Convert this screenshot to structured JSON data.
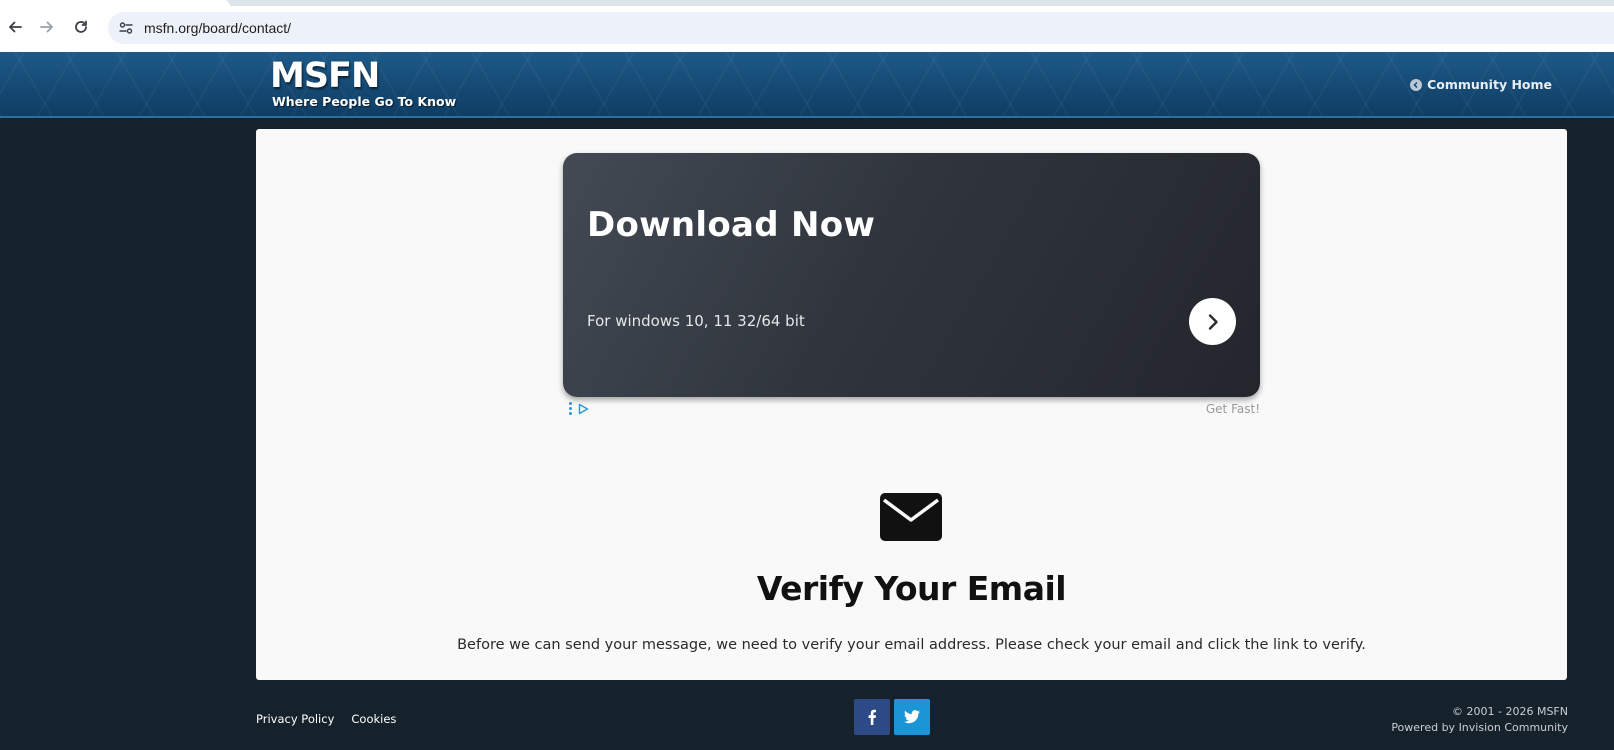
{
  "browser": {
    "url": "msfn.org/board/contact/",
    "back_icon": "arrow-left-icon",
    "forward_icon": "arrow-right-icon",
    "reload_icon": "reload-icon",
    "site_info_icon": "tune-icon"
  },
  "header": {
    "logo_title": "MSFN",
    "logo_tagline": "Where People Go To Know",
    "community_home_label": "Community Home",
    "colors": {
      "header_bg": "#154a74",
      "page_bg": "#15212b"
    }
  },
  "ad": {
    "title": "Download Now",
    "subtitle": "For windows 10, 11 32/64 bit",
    "brand": "Get Fast!",
    "arrow_icon": "chevron-right-icon",
    "choices_icon": "ad-choices-icon"
  },
  "main": {
    "icon": "envelope-icon",
    "title": "Verify Your Email",
    "description": "Before we can send your message, we need to verify your email address. Please check your email and click the link to verify."
  },
  "footer": {
    "links": [
      "Privacy Policy",
      "Cookies"
    ],
    "social": [
      {
        "name": "facebook",
        "icon": "facebook-icon",
        "color": "#2c4a86"
      },
      {
        "name": "twitter",
        "icon": "twitter-icon",
        "color": "#1b95d6"
      }
    ],
    "copyright": "© 2001 - 2026 MSFN",
    "powered_by": "Powered by Invision Community"
  }
}
